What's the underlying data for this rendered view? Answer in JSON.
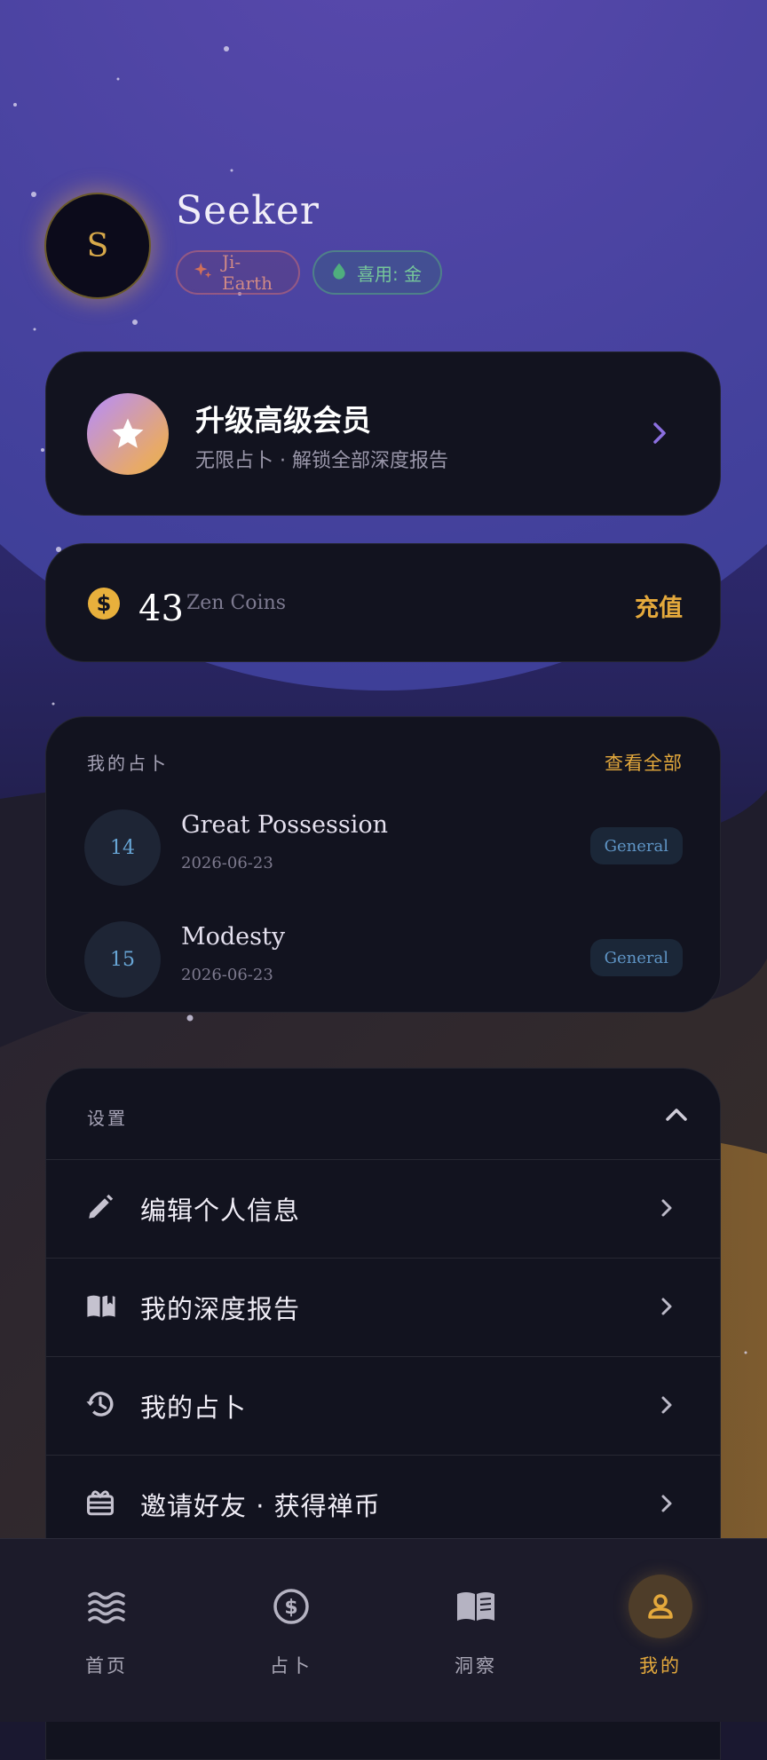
{
  "profile": {
    "avatar_letter": "S",
    "name": "Seeker",
    "tags": [
      {
        "label": "Ji-Earth",
        "icon": "sparkle-icon"
      },
      {
        "label": "喜用: 金",
        "icon": "droplet-icon"
      }
    ]
  },
  "premium": {
    "title": "升级高级会员",
    "subtitle": "无限占卜 · 解锁全部深度报告",
    "icon": "star-icon"
  },
  "coins": {
    "amount": "43",
    "label": "Zen Coins",
    "recharge_label": "充值",
    "icon": "dollar-coin-icon"
  },
  "readings": {
    "section_title": "我的占卜",
    "view_all_label": "查看全部",
    "items": [
      {
        "number": "14",
        "title": "Great Possession",
        "date": "2026-06-23",
        "category": "General"
      },
      {
        "number": "15",
        "title": "Modesty",
        "date": "2026-06-23",
        "category": "General"
      }
    ]
  },
  "settings": {
    "section_title": "设置",
    "items": [
      {
        "label": "编辑个人信息",
        "icon": "pencil-icon"
      },
      {
        "label": "我的深度报告",
        "icon": "open-book-icon"
      },
      {
        "label": "我的占卜",
        "icon": "history-icon"
      },
      {
        "label": "邀请好友 · 获得禅币",
        "icon": "gift-icon"
      }
    ]
  },
  "nav": {
    "items": [
      {
        "label": "首页",
        "icon": "waves-icon",
        "active": false
      },
      {
        "label": "占卜",
        "icon": "dollar-circle-icon",
        "active": false
      },
      {
        "label": "洞察",
        "icon": "newspaper-book-icon",
        "active": false
      },
      {
        "label": "我的",
        "icon": "person-icon",
        "active": true
      }
    ]
  },
  "colors": {
    "accent_gold": "#e4a93c",
    "card_bg": "#12131f",
    "background": "#1a1830",
    "moon": "#5046a6"
  }
}
